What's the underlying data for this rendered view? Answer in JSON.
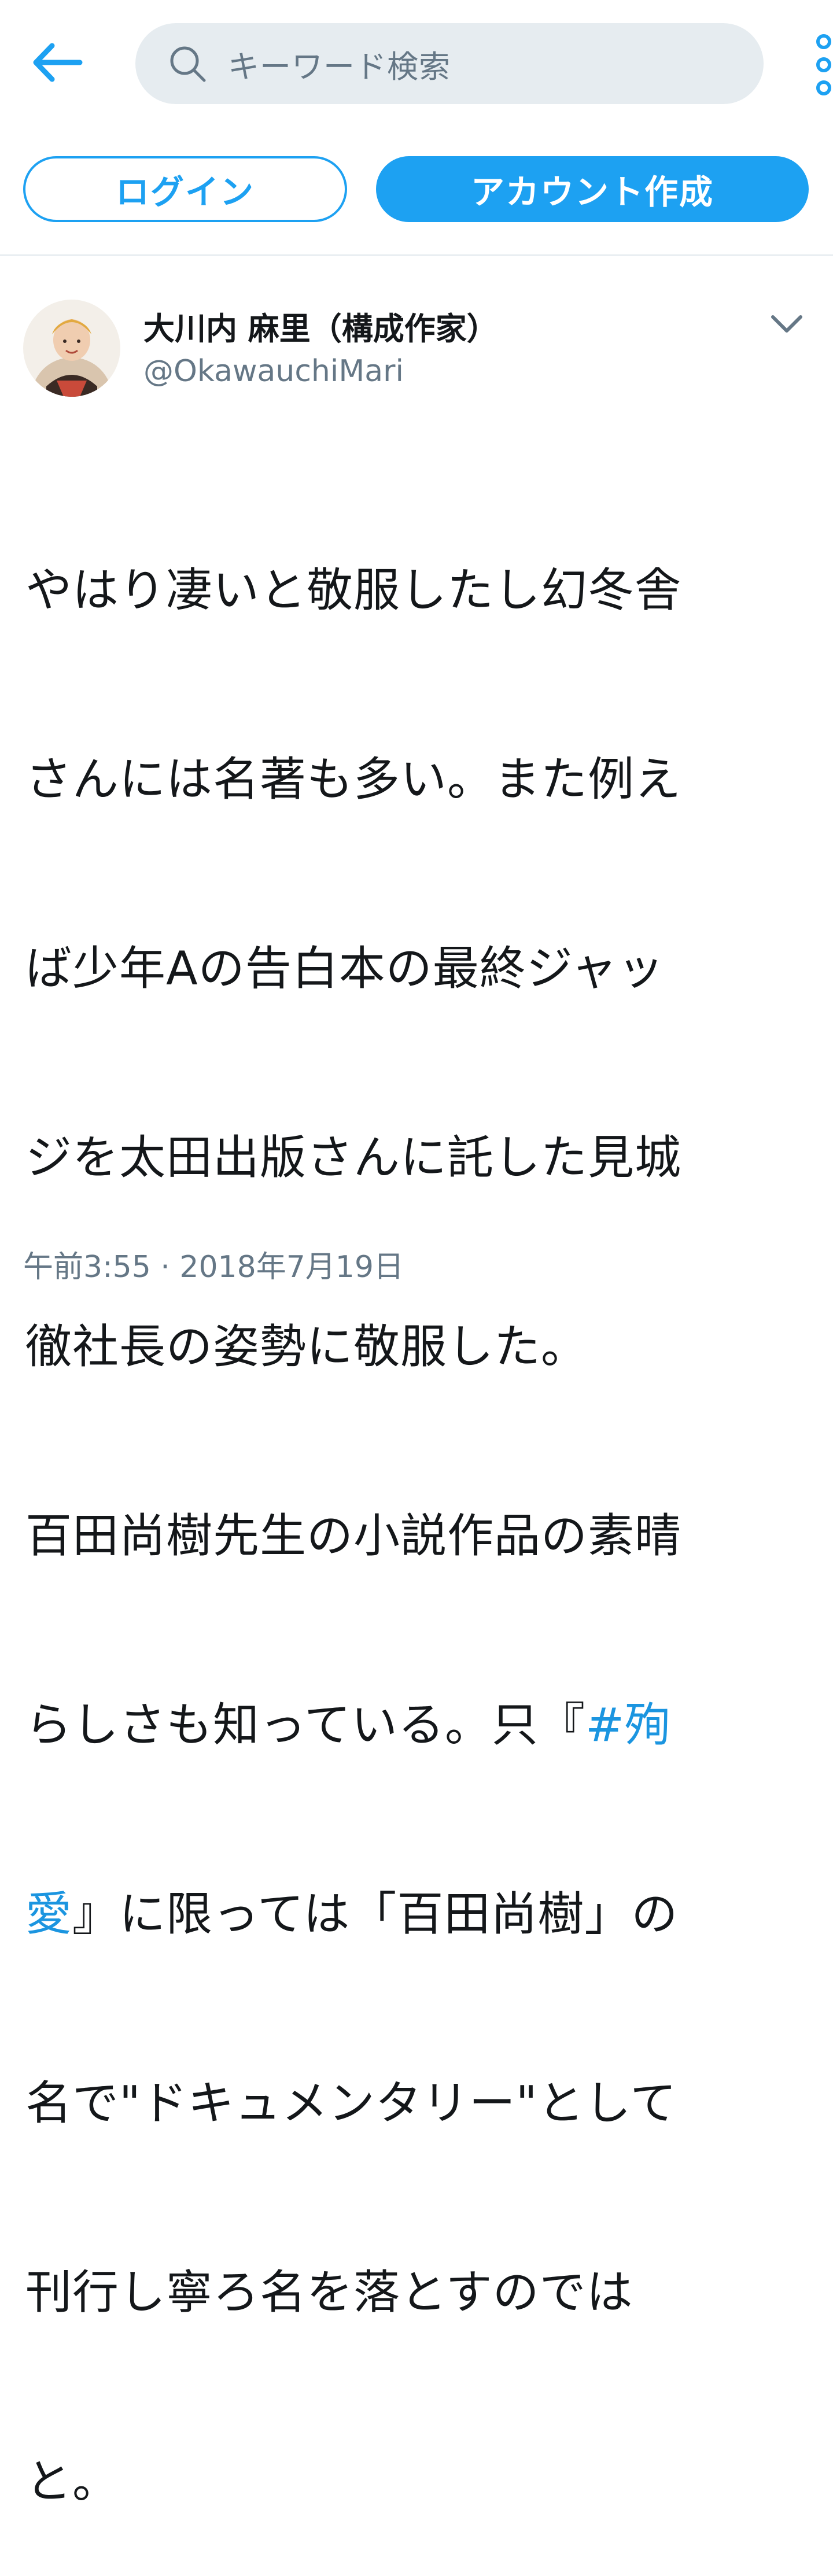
{
  "colors": {
    "accent": "#1da1f2",
    "link": "#1b95e0",
    "text": "#14171a",
    "secondary_text": "#657786",
    "search_bg": "#e6ecf0",
    "divider": "#e1e8ed"
  },
  "header": {
    "back_icon": "arrow-left-icon",
    "search": {
      "icon": "search-icon",
      "placeholder": "キーワード検索"
    },
    "more_icon": "more-vertical-icon"
  },
  "auth": {
    "login_label": "ログイン",
    "signup_label": "アカウント作成"
  },
  "tweet": {
    "author": {
      "display_name": "大川内 麻里（構成作家）",
      "handle": "@OkawauchiMari",
      "avatar_icon": "avatar-photo"
    },
    "menu_icon": "chevron-down-icon",
    "lines": [
      "やはり凄いと敬服したし幻冬舎",
      "さんには名著も多い。また例え",
      "ば少年Aの告白本の最終ジャッ",
      "ジを太田出版さんに託した見城",
      "徹社長の姿勢に敬服した。",
      "百田尚樹先生の小説作品の素晴",
      "らしさも知っている。只『",
      "#殉",
      "愛",
      "』に限っては「百田尚樹」の",
      "名で\"ドキュメンタリー\"として",
      "刊行し寧ろ名を落とすのでは",
      "と。"
    ],
    "timestamp": "午前3:55 · 2018年7月19日"
  }
}
